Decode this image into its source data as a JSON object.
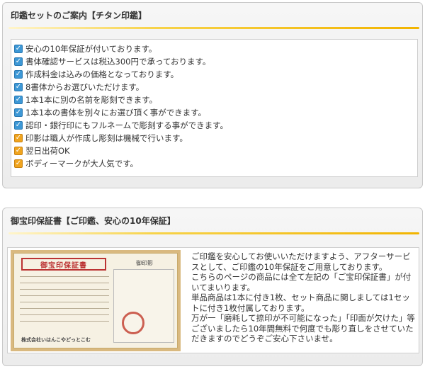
{
  "section1": {
    "title": "印鑑セットのご案内【チタン印鑑】",
    "items": [
      {
        "text": "安心の10年保証が付いております。",
        "check": "blue"
      },
      {
        "text": "書体確認サービスは税込300円で承っております。",
        "check": "blue"
      },
      {
        "text": "作成料金は込みの価格となっております。",
        "check": "blue"
      },
      {
        "text": "8書体からお選びいただけます。",
        "check": "blue"
      },
      {
        "text": "1本1本に別の名前を彫刻できます。",
        "check": "blue"
      },
      {
        "text": "1本1本の書体を別々にお選び頂く事ができます。",
        "check": "blue"
      },
      {
        "text": "認印・銀行印にもフルネームで彫刻する事ができます。",
        "check": "blue"
      },
      {
        "text": "印影は職人が作成し彫刻は機械で行います。",
        "check": "orange"
      },
      {
        "text": "翌日出荷OK",
        "check": "orange"
      },
      {
        "text": "ボディーマークが大人気です。",
        "check": "orange"
      }
    ]
  },
  "section2": {
    "title": "御宝印保証書【ご印鑑、安心の10年保証】",
    "certificate": {
      "title": "御宝印保証書",
      "seal_label": "御印影",
      "company": "株式会社いはんこやどっとこむ"
    },
    "paragraphs": [
      "ご印鑑を安心してお使いいただけますよう、アフターサービスとして、ご印鑑の10年保証をご用意しております。",
      "こちらのページの商品には全て左記の「ご宝印保証書」が付いてまいります。",
      "単品商品は1本に付き1枚、セット商品に関しましては1セットに付き1枚付属しております。",
      "万が一「磨耗して捺印が不可能になった」「印面が欠けた」等ございましたら10年間無料で何度でも彫り直しをさせていただきますのでどうぞご安心下さいませ。"
    ]
  }
}
